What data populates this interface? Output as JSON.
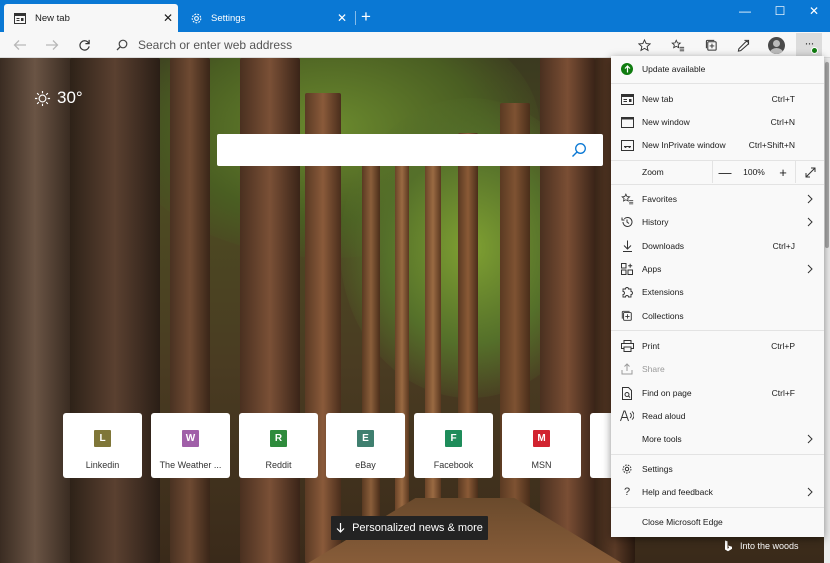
{
  "window": {
    "tabs": [
      {
        "label": "New tab",
        "active": true,
        "icon": "newtab-page-icon"
      },
      {
        "label": "Settings",
        "active": false,
        "icon": "gear-icon"
      }
    ],
    "new_tab_symbol": "+",
    "close_symbol": "✕",
    "controls": {
      "minimize": "—",
      "maximize": "☐",
      "close": "✕"
    }
  },
  "toolbar": {
    "address_placeholder": "Search or enter web address",
    "profile_badge_color": "#107c10"
  },
  "page": {
    "weather": {
      "temp": "30°",
      "icon": "sun-icon"
    },
    "search_placeholder": "",
    "tiles": [
      {
        "letter": "L",
        "label": "Linkedin",
        "color": "#7f7638"
      },
      {
        "letter": "W",
        "label": "The Weather ...",
        "color": "#a05fa8"
      },
      {
        "letter": "R",
        "label": "Reddit",
        "color": "#2e8b3c"
      },
      {
        "letter": "E",
        "label": "eBay",
        "color": "#3f7f6f"
      },
      {
        "letter": "F",
        "label": "Facebook",
        "color": "#1e8c5a"
      },
      {
        "letter": "M",
        "label": "MSN",
        "color": "#d1232f"
      }
    ],
    "news_button": "Personalized news & more",
    "credit": "Into the woods"
  },
  "menu": {
    "update": "Update available",
    "new_tab": {
      "label": "New tab",
      "shortcut": "Ctrl+T"
    },
    "new_window": {
      "label": "New window",
      "shortcut": "Ctrl+N"
    },
    "new_inprivate": {
      "label": "New InPrivate window",
      "shortcut": "Ctrl+Shift+N"
    },
    "zoom": {
      "label": "Zoom",
      "minus": "—",
      "value": "100%",
      "plus": "+"
    },
    "favorites": "Favorites",
    "history": "History",
    "downloads": {
      "label": "Downloads",
      "shortcut": "Ctrl+J"
    },
    "apps": "Apps",
    "extensions": "Extensions",
    "collections": "Collections",
    "print": {
      "label": "Print",
      "shortcut": "Ctrl+P"
    },
    "share": "Share",
    "find": {
      "label": "Find on page",
      "shortcut": "Ctrl+F"
    },
    "read_aloud": "Read aloud",
    "more_tools": "More tools",
    "settings": "Settings",
    "help": "Help and feedback",
    "close": "Close Microsoft Edge"
  },
  "colors": {
    "titlebar": "#0a78d4",
    "update_green": "#107c10"
  }
}
